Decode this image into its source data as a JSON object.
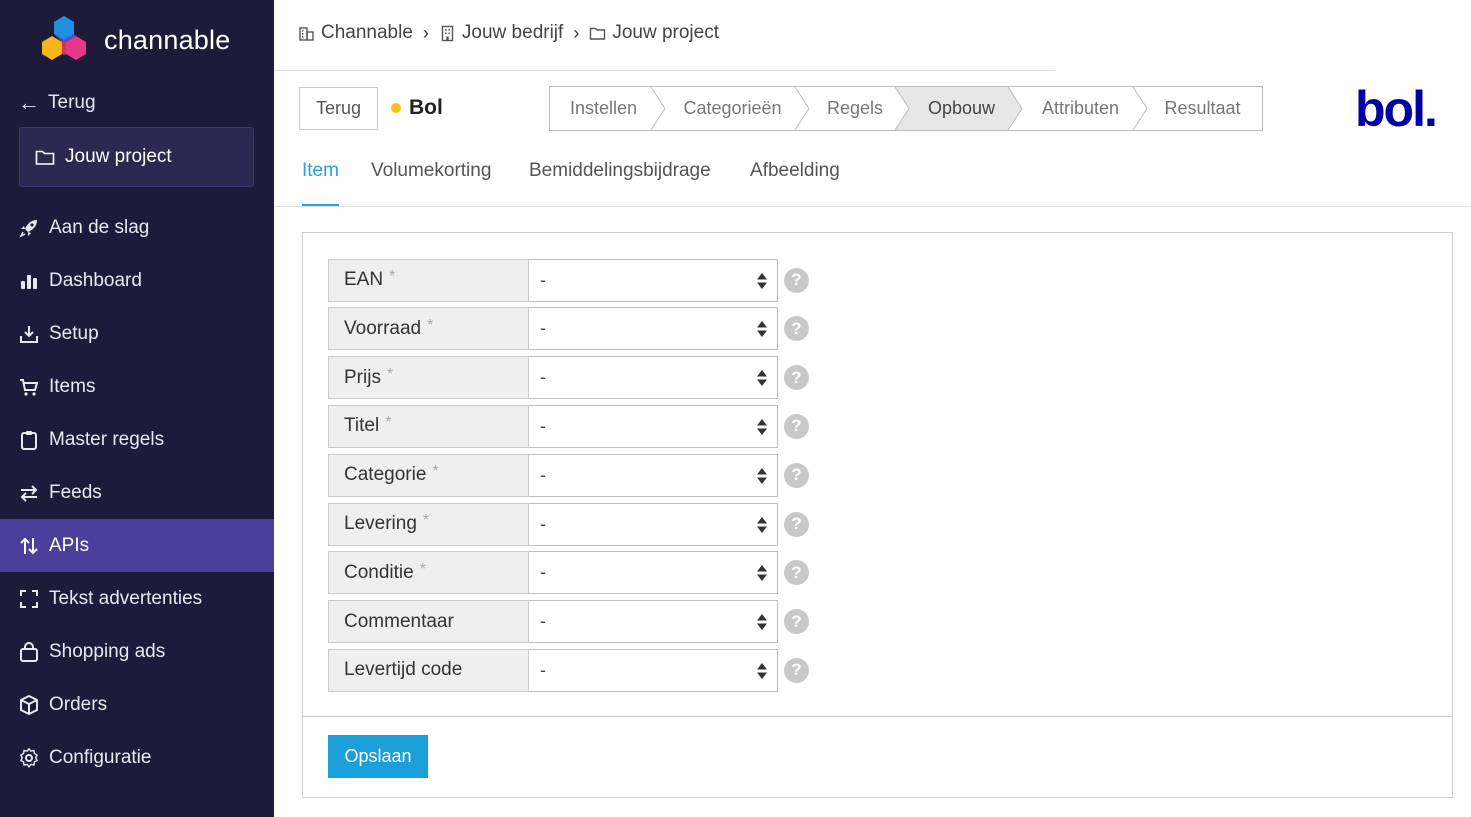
{
  "brand": {
    "name": "channable"
  },
  "sidebar": {
    "back_label": "Terug",
    "project_label": "Jouw project",
    "items": [
      {
        "label": "Aan de slag",
        "icon": "rocket-icon"
      },
      {
        "label": "Dashboard",
        "icon": "bar-chart-icon"
      },
      {
        "label": "Setup",
        "icon": "download-tray-icon"
      },
      {
        "label": "Items",
        "icon": "cart-icon"
      },
      {
        "label": "Master regels",
        "icon": "clipboard-icon"
      },
      {
        "label": "Feeds",
        "icon": "arrows-exchange-icon"
      },
      {
        "label": "APIs",
        "icon": "up-down-arrows-icon"
      },
      {
        "label": "Tekst advertenties",
        "icon": "frame-corners-icon"
      },
      {
        "label": "Shopping ads",
        "icon": "shopping-bag-icon"
      },
      {
        "label": "Orders",
        "icon": "box-icon"
      },
      {
        "label": "Configuratie",
        "icon": "gear-icon"
      }
    ],
    "active_index": 6
  },
  "breadcrumb": [
    {
      "label": "Channable",
      "icon": "office-building-icon"
    },
    {
      "label": "Jouw bedrijf",
      "icon": "building-icon"
    },
    {
      "label": "Jouw project",
      "icon": "folder-icon"
    }
  ],
  "header": {
    "back_button": "Terug",
    "channel_name": "Bol",
    "channel_status_color": "#f2c40f",
    "logo_text": "bol."
  },
  "steps": [
    {
      "label": "Instellen"
    },
    {
      "label": "Categorieën"
    },
    {
      "label": "Regels"
    },
    {
      "label": "Opbouw",
      "current": true
    },
    {
      "label": "Attributen"
    },
    {
      "label": "Resultaat"
    }
  ],
  "tabs": [
    {
      "label": "Item",
      "active": true
    },
    {
      "label": "Volumekorting"
    },
    {
      "label": "Bemiddelingsbijdrage"
    },
    {
      "label": "Afbeelding"
    }
  ],
  "form": {
    "fields": [
      {
        "label": "EAN",
        "required": true,
        "value": "-"
      },
      {
        "label": "Voorraad",
        "required": true,
        "value": "-"
      },
      {
        "label": "Prijs",
        "required": true,
        "value": "-"
      },
      {
        "label": "Titel",
        "required": true,
        "value": "-"
      },
      {
        "label": "Categorie",
        "required": true,
        "value": "-"
      },
      {
        "label": "Levering",
        "required": true,
        "value": "-"
      },
      {
        "label": "Conditie",
        "required": true,
        "value": "-"
      },
      {
        "label": "Commentaar",
        "required": false,
        "value": "-"
      },
      {
        "label": "Levertijd code",
        "required": false,
        "value": "-"
      }
    ],
    "required_marker": "*",
    "help_glyph": "?",
    "save_label": "Opslaan"
  },
  "colors": {
    "sidebar_bg": "#1e1b3a",
    "sidebar_active": "#4a3f9a",
    "accent": "#2d9fd9",
    "save_button": "#1a9fd9",
    "bol_blue": "#0000a4"
  }
}
